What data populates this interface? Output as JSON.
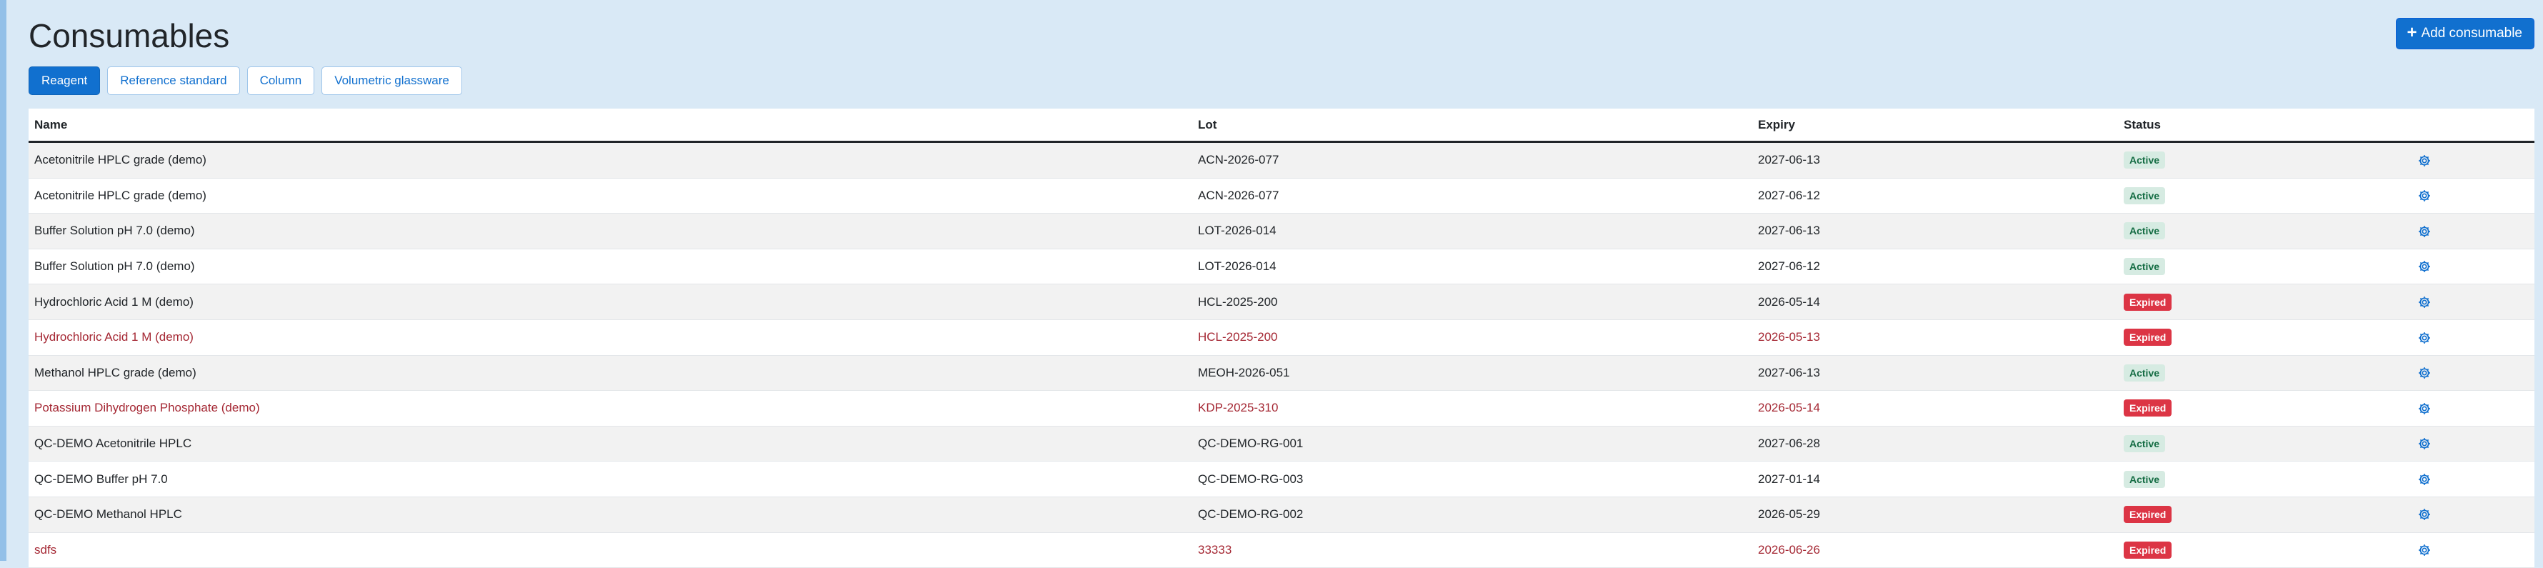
{
  "page": {
    "title": "Consumables",
    "add_button_label": "Add consumable"
  },
  "filters": [
    {
      "label": "Reagent",
      "active": true
    },
    {
      "label": "Reference standard",
      "active": false
    },
    {
      "label": "Column",
      "active": false
    },
    {
      "label": "Volumetric glassware",
      "active": false
    }
  ],
  "table": {
    "columns": [
      "Name",
      "Lot",
      "Expiry",
      "Status",
      ""
    ],
    "rows": [
      {
        "name": "Acetonitrile HPLC grade (demo)",
        "lot": "ACN-2026-077",
        "expiry": "2027-06-13",
        "status": "Active",
        "highlight": false
      },
      {
        "name": "Acetonitrile HPLC grade (demo)",
        "lot": "ACN-2026-077",
        "expiry": "2027-06-12",
        "status": "Active",
        "highlight": false
      },
      {
        "name": "Buffer Solution pH 7.0 (demo)",
        "lot": "LOT-2026-014",
        "expiry": "2027-06-13",
        "status": "Active",
        "highlight": false
      },
      {
        "name": "Buffer Solution pH 7.0 (demo)",
        "lot": "LOT-2026-014",
        "expiry": "2027-06-12",
        "status": "Active",
        "highlight": false
      },
      {
        "name": "Hydrochloric Acid 1 M (demo)",
        "lot": "HCL-2025-200",
        "expiry": "2026-05-14",
        "status": "Expired",
        "highlight": false
      },
      {
        "name": "Hydrochloric Acid 1 M (demo)",
        "lot": "HCL-2025-200",
        "expiry": "2026-05-13",
        "status": "Expired",
        "highlight": true
      },
      {
        "name": "Methanol HPLC grade (demo)",
        "lot": "MEOH-2026-051",
        "expiry": "2027-06-13",
        "status": "Active",
        "highlight": false
      },
      {
        "name": "Potassium Dihydrogen Phosphate (demo)",
        "lot": "KDP-2025-310",
        "expiry": "2026-05-14",
        "status": "Expired",
        "highlight": true
      },
      {
        "name": "QC-DEMO Acetonitrile HPLC",
        "lot": "QC-DEMO-RG-001",
        "expiry": "2027-06-28",
        "status": "Active",
        "highlight": false
      },
      {
        "name": "QC-DEMO Buffer pH 7.0",
        "lot": "QC-DEMO-RG-003",
        "expiry": "2027-01-14",
        "status": "Active",
        "highlight": false
      },
      {
        "name": "QC-DEMO Methanol HPLC",
        "lot": "QC-DEMO-RG-002",
        "expiry": "2026-05-29",
        "status": "Expired",
        "highlight": false
      },
      {
        "name": "sdfs",
        "lot": "33333",
        "expiry": "2026-06-26",
        "status": "Expired",
        "highlight": true
      }
    ]
  },
  "icons": {
    "add": "plus-icon",
    "row_action": "gear-icon"
  },
  "colors": {
    "primary": "#1170cf",
    "expired_badge": "#dc3545",
    "active_badge_bg": "#d6ebe2",
    "expired_text": "#a52834",
    "page_background": "#d9e9f6"
  }
}
